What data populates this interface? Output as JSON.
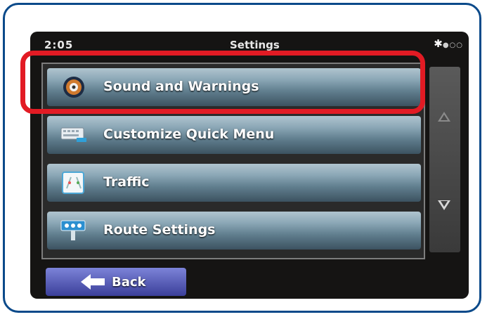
{
  "status_bar": {
    "clock": "2:05",
    "title": "Settings"
  },
  "menu": {
    "items": [
      {
        "label": "Sound and Warnings",
        "icon": "speaker-icon"
      },
      {
        "label": "Customize Quick Menu",
        "icon": "keyboard-icon"
      },
      {
        "label": "Traffic",
        "icon": "traffic-icon"
      },
      {
        "label": "Route Settings",
        "icon": "route-icon"
      }
    ]
  },
  "back_button": {
    "label": "Back"
  },
  "colors": {
    "highlight": "#e21b24",
    "frame": "#0b4a8a",
    "back": "#4b51b5"
  }
}
